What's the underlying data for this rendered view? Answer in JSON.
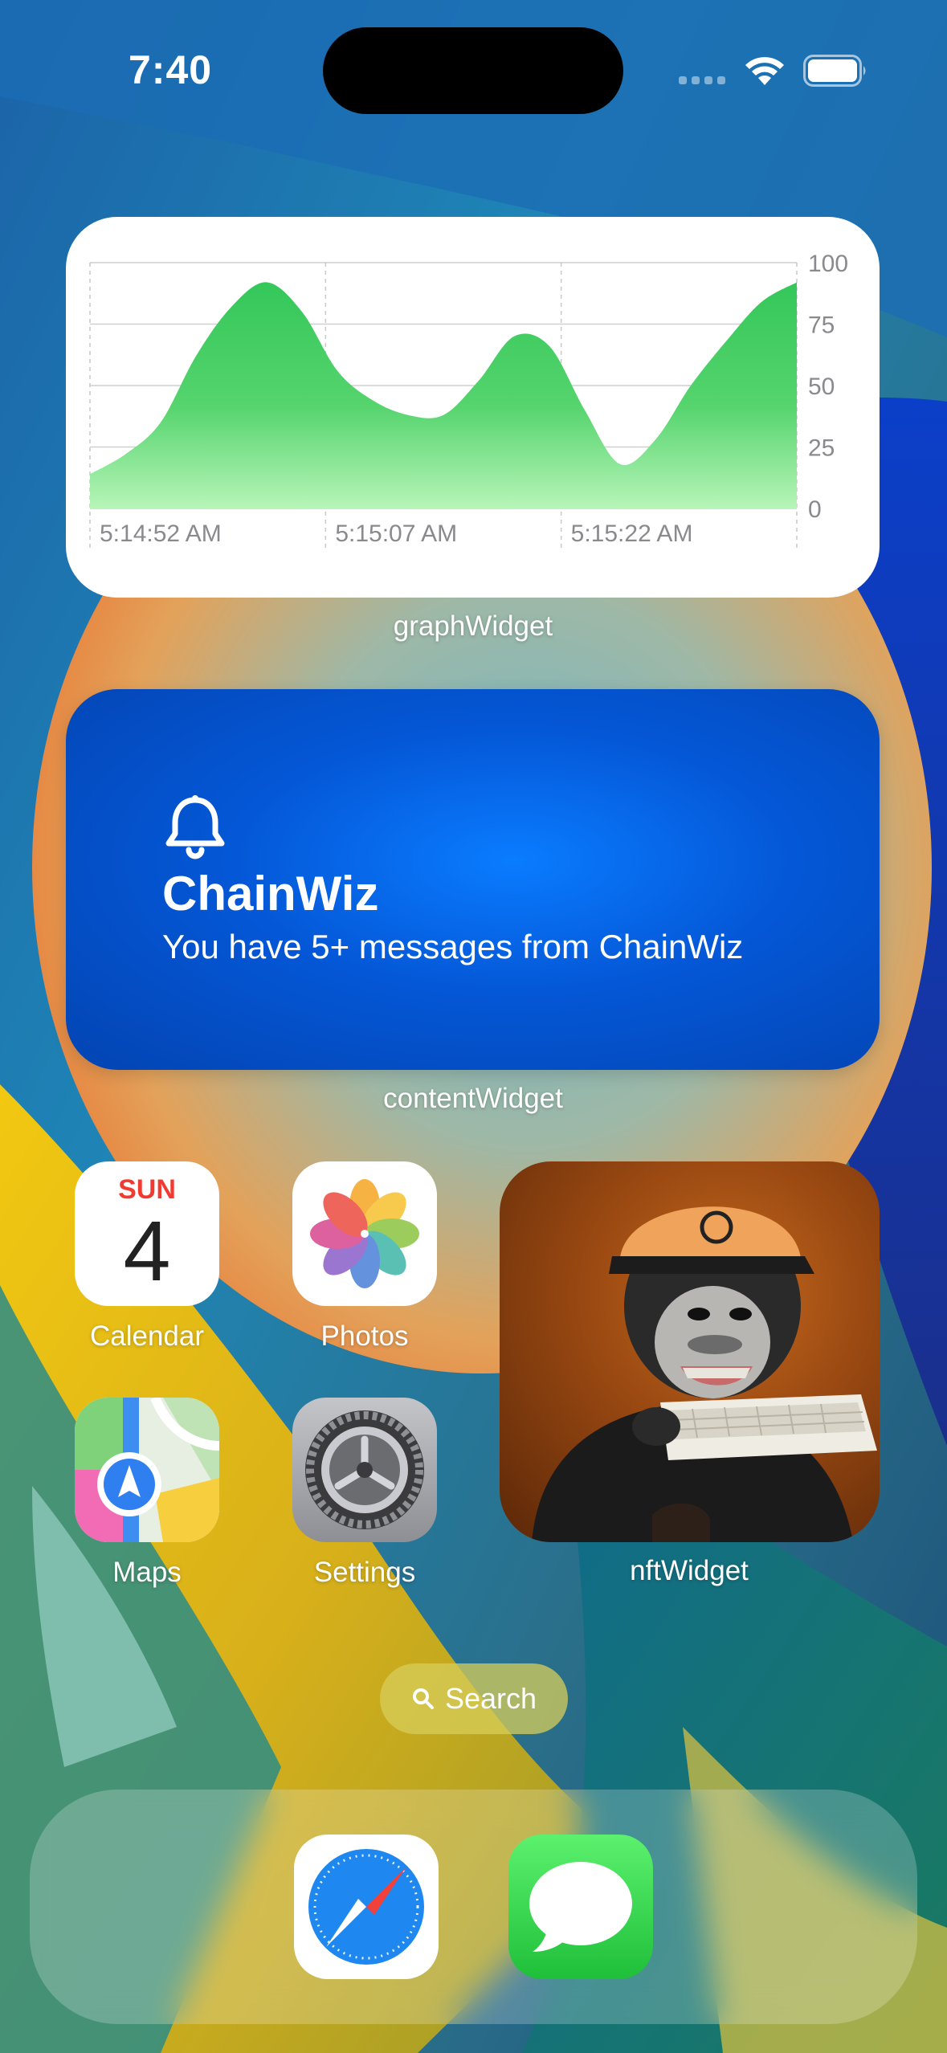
{
  "status_bar": {
    "time": "7:40"
  },
  "graph_widget": {
    "label": "graphWidget",
    "accent_color": "#34c759"
  },
  "chart_data": {
    "type": "area",
    "x": [
      "5:14:52 AM",
      "5:15:07 AM",
      "5:15:22 AM"
    ],
    "y_ticks": [
      100,
      75,
      50,
      25,
      0
    ],
    "ylim": [
      0,
      100
    ],
    "series": [
      {
        "values": [
          14,
          22,
          35,
          62,
          82,
          92,
          80,
          56,
          44,
          38,
          38,
          52,
          70,
          66,
          40,
          18,
          28,
          50,
          68,
          84,
          92
        ]
      }
    ],
    "grid": true,
    "fill_color": "#34c759"
  },
  "content_widget": {
    "title": "ChainWiz",
    "message": "You have 5+ messages from ChainWiz",
    "label": "contentWidget",
    "icon": "bell-icon"
  },
  "apps": {
    "calendar": {
      "label": "Calendar",
      "day": "SUN",
      "date": "4"
    },
    "photos": {
      "label": "Photos"
    },
    "maps": {
      "label": "Maps"
    },
    "settings": {
      "label": "Settings"
    }
  },
  "nft_widget": {
    "label": "nftWidget"
  },
  "search": {
    "label": "Search"
  },
  "dock": {
    "apps": [
      "safari-icon",
      "messages-icon"
    ]
  }
}
